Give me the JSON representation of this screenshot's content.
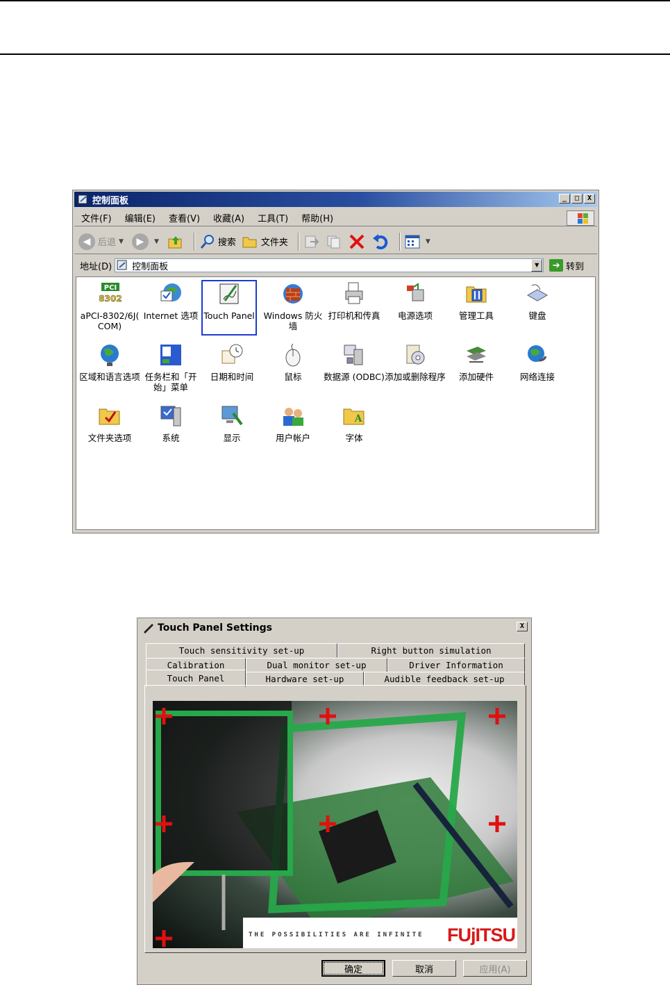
{
  "control_panel": {
    "title": "控制面板",
    "window_buttons": {
      "minimize": "_",
      "maximize": "□",
      "close": "X"
    },
    "menu": [
      "文件(F)",
      "编辑(E)",
      "查看(V)",
      "收藏(A)",
      "工具(T)",
      "帮助(H)"
    ],
    "toolbar": {
      "back": "后退",
      "search": "搜索",
      "folders": "文件夹"
    },
    "address": {
      "label": "地址(D)",
      "value": "控制面板",
      "go": "转到"
    },
    "items": [
      {
        "label": "aPCI-8302/6J( COM)",
        "icon": "pci-card-icon"
      },
      {
        "label": "Internet 选项",
        "icon": "internet-globe-icon"
      },
      {
        "label": "Touch Panel",
        "icon": "touch-pen-icon"
      },
      {
        "label": "Windows 防火墙",
        "icon": "firewall-icon"
      },
      {
        "label": "打印机和传真",
        "icon": "printer-icon"
      },
      {
        "label": "电源选项",
        "icon": "power-icon"
      },
      {
        "label": "管理工具",
        "icon": "admin-tools-icon"
      },
      {
        "label": "键盘",
        "icon": "keyboard-icon"
      },
      {
        "label": "区域和语言选项",
        "icon": "globe-icon"
      },
      {
        "label": "任务栏和「开始」菜单",
        "icon": "taskbar-icon"
      },
      {
        "label": "日期和时间",
        "icon": "calendar-clock-icon"
      },
      {
        "label": "鼠标",
        "icon": "mouse-icon"
      },
      {
        "label": "数据源 (ODBC)",
        "icon": "database-icon"
      },
      {
        "label": "添加或删除程序",
        "icon": "add-remove-icon"
      },
      {
        "label": "添加硬件",
        "icon": "hardware-icon"
      },
      {
        "label": "网络连接",
        "icon": "network-icon"
      },
      {
        "label": "文件夹选项",
        "icon": "folder-options-icon"
      },
      {
        "label": "系统",
        "icon": "system-icon"
      },
      {
        "label": "显示",
        "icon": "display-icon"
      },
      {
        "label": "用户帐户",
        "icon": "users-icon"
      },
      {
        "label": "字体",
        "icon": "fonts-icon"
      }
    ]
  },
  "touch_panel_dialog": {
    "title": "Touch Panel Settings",
    "close": "X",
    "tabs_row1": [
      "Touch sensitivity set-up",
      "Right button simulation"
    ],
    "tabs_row2": [
      "Calibration",
      "Dual monitor set-up",
      "Driver Information"
    ],
    "tabs_row3": [
      "Touch Panel",
      "Hardware set-up",
      "Audible feedback set-up"
    ],
    "active_tab": "Touch Panel",
    "banner_text": "THE POSSIBILITIES ARE INFINITE",
    "brand": "FUjITSU",
    "buttons": {
      "ok": "确定",
      "cancel": "取消",
      "apply": "应用(A)"
    }
  }
}
